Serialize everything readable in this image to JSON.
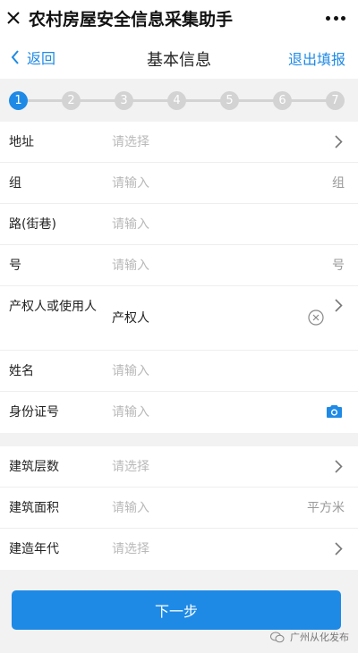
{
  "app": {
    "title": "农村房屋安全信息采集助手"
  },
  "nav": {
    "back_label": "返回",
    "title": "基本信息",
    "exit_label": "退出填报"
  },
  "steps": [
    "1",
    "2",
    "3",
    "4",
    "5",
    "6",
    "7"
  ],
  "current_step": 1,
  "colors": {
    "accent": "#1e8ae6",
    "inactive": "#d3d3d3"
  },
  "section1": {
    "address": {
      "label": "地址",
      "placeholder": "请选择"
    },
    "group": {
      "label": "组",
      "placeholder": "请输入",
      "unit": "组"
    },
    "road": {
      "label": "路(街巷)",
      "placeholder": "请输入"
    },
    "number": {
      "label": "号",
      "placeholder": "请输入",
      "unit": "号"
    },
    "owner_type": {
      "label": "产权人或使用人",
      "value": "产权人"
    },
    "name": {
      "label": "姓名",
      "placeholder": "请输入"
    },
    "id_number": {
      "label": "身份证号",
      "placeholder": "请输入"
    }
  },
  "section2": {
    "floors": {
      "label": "建筑层数",
      "placeholder": "请选择"
    },
    "area": {
      "label": "建筑面积",
      "placeholder": "请输入",
      "unit": "平方米"
    },
    "year": {
      "label": "建造年代",
      "placeholder": "请选择"
    }
  },
  "footer": {
    "next_label": "下一步",
    "watermark": "广州从化发布"
  }
}
